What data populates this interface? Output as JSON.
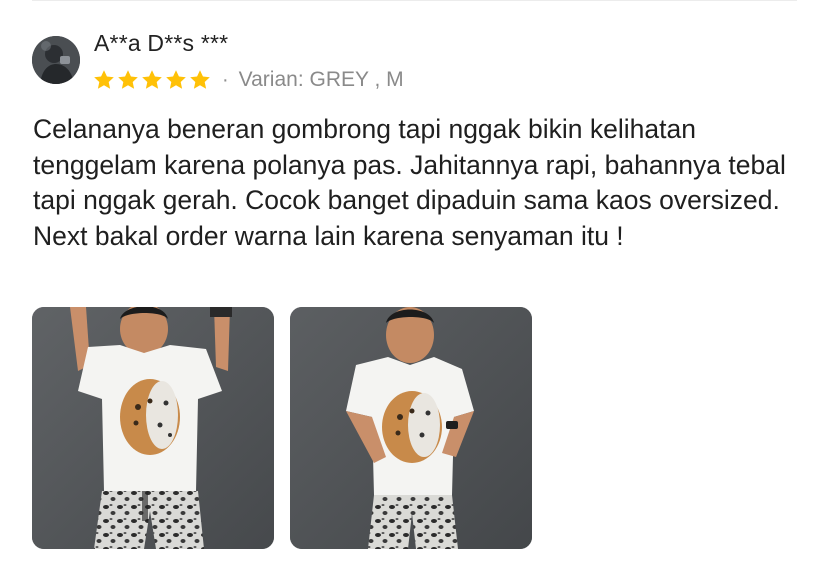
{
  "review": {
    "username": "A**a D**s ***",
    "rating": 5,
    "rating_max": 5,
    "separator": "·",
    "variant": "Varian: GREY , M",
    "text": "Celananya beneran gombrong tapi nggak bikin kelihatan tenggelam karena polanya pas. Jahitannya rapi, bahannya tebal tapi nggak gerah. Cocok banget dipaduin sama kaos oversized. Next bakal order warna lain karena senyaman itu !",
    "photos": [
      {
        "description": "photo-1"
      },
      {
        "description": "photo-2"
      }
    ]
  },
  "colors": {
    "star": "#FFC107",
    "text": "#1f1f1f",
    "muted": "#8a8a8a",
    "photo_bg": "#55585b"
  }
}
